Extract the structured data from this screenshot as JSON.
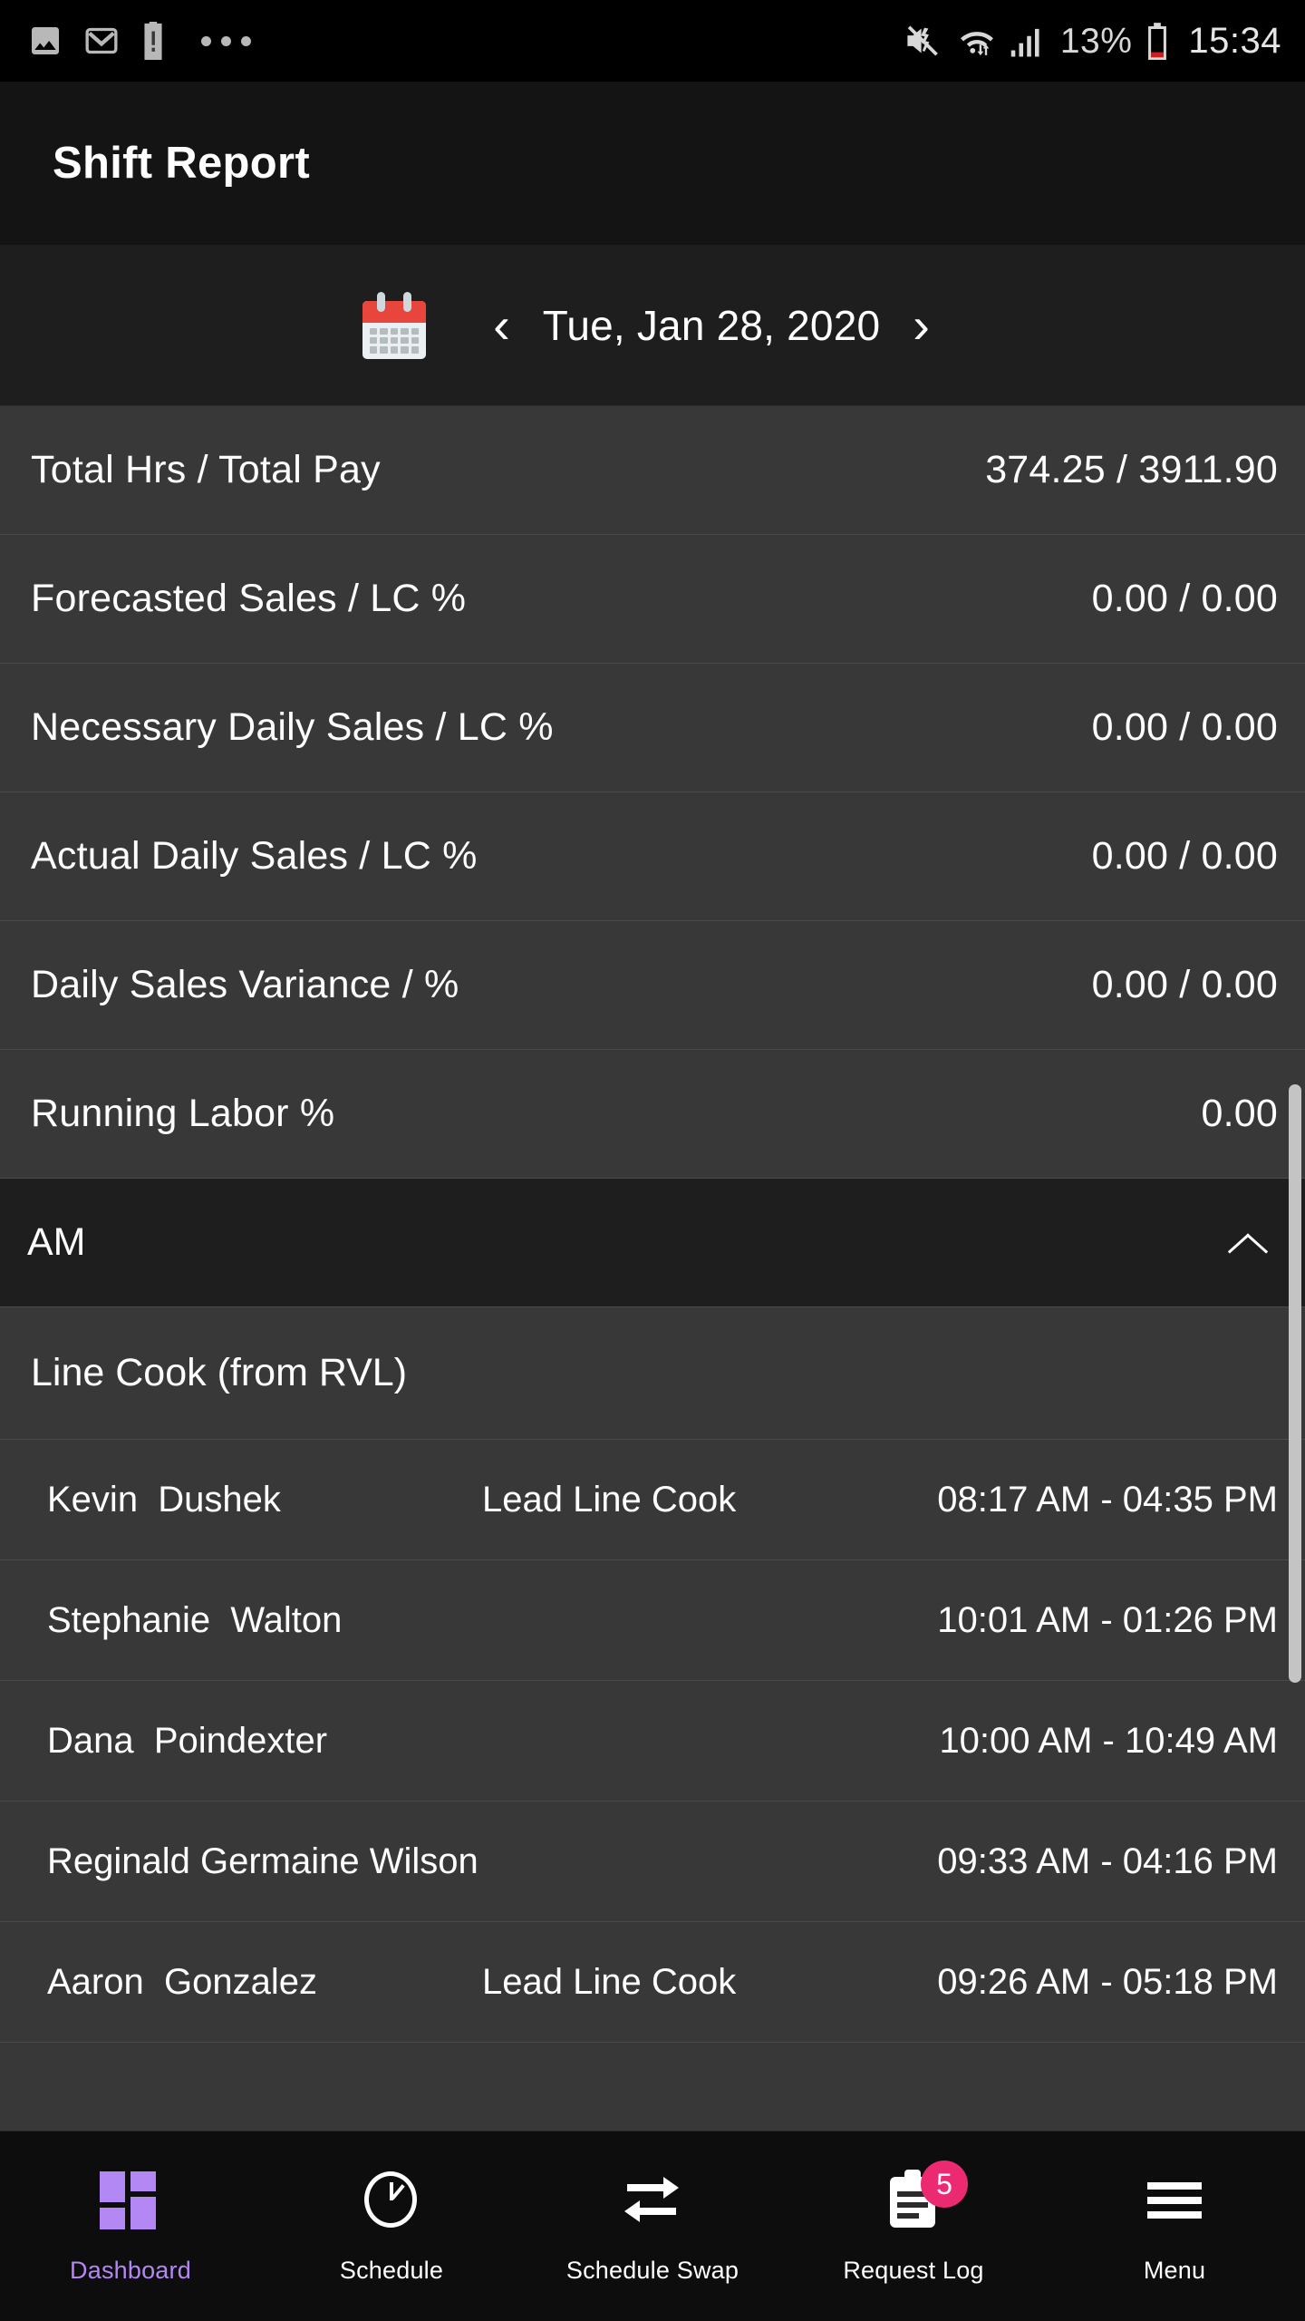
{
  "status_bar": {
    "left_icons": [
      "photo-icon",
      "gmail-icon",
      "battery-alert-icon",
      "overflow-dots-icon"
    ],
    "right_icons": [
      "mute-icon",
      "wifi-icon",
      "signal-icon",
      "battery-icon"
    ],
    "battery_percent": "13%",
    "clock": "15:34"
  },
  "app_bar": {
    "title": "Shift Report"
  },
  "date_nav": {
    "calendar_icon": "calendar-icon",
    "prev_label": "‹",
    "date": "Tue, Jan 28, 2020",
    "next_label": "›"
  },
  "stats": [
    {
      "label": "Total Hrs / Total Pay",
      "value": "374.25 / 3911.90"
    },
    {
      "label": "Forecasted Sales / LC %",
      "value": "0.00 / 0.00"
    },
    {
      "label": "Necessary Daily Sales / LC %",
      "value": "0.00 / 0.00"
    },
    {
      "label": "Actual Daily Sales / LC %",
      "value": "0.00 / 0.00"
    },
    {
      "label": "Daily Sales Variance / %",
      "value": "0.00 / 0.00"
    },
    {
      "label": "Running Labor %",
      "value": "0.00"
    }
  ],
  "shift_section": {
    "title": "AM",
    "collapse_icon": "chevron-up-icon",
    "role_group": "Line Cook (from RVL)",
    "employees": [
      {
        "name": "Kevin  Dushek",
        "role": "Lead Line Cook",
        "time": "08:17 AM - 04:35 PM"
      },
      {
        "name": "Stephanie  Walton",
        "role": "",
        "time": "10:01 AM - 01:26 PM"
      },
      {
        "name": "Dana  Poindexter",
        "role": "",
        "time": "10:00 AM - 10:49 AM"
      },
      {
        "name": "Reginald Germaine Wilson",
        "role": "",
        "time": "09:33 AM - 04:16 PM"
      },
      {
        "name": "Aaron  Gonzalez",
        "role": "Lead Line Cook",
        "time": "09:26 AM - 05:18 PM"
      }
    ]
  },
  "bottom_nav": {
    "active_color": "#b388f5",
    "badge_color": "#ec2a72",
    "items": [
      {
        "label": "Dashboard",
        "icon": "dashboard-grid-icon",
        "badge": ""
      },
      {
        "label": "Schedule",
        "icon": "clock-icon",
        "badge": ""
      },
      {
        "label": "Schedule Swap",
        "icon": "swap-arrows-icon",
        "badge": ""
      },
      {
        "label": "Request Log",
        "icon": "clipboard-icon",
        "badge": "5"
      },
      {
        "label": "Menu",
        "icon": "hamburger-menu-icon",
        "badge": ""
      }
    ]
  }
}
